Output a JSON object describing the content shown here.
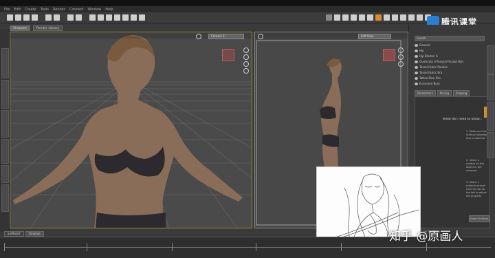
{
  "menu": {
    "items": [
      "File",
      "Edit",
      "Create",
      "Tools",
      "Render",
      "Connect",
      "Window",
      "Help"
    ]
  },
  "viewport_tabs": {
    "viewport": "Viewport",
    "render_library": "Render Library"
  },
  "viewport1": {
    "camera": "Camera 2"
  },
  "viewport2": {
    "camera": "Left View"
  },
  "scene_panel": {
    "search": "Search",
    "items": [
      "Genesis",
      "Hip",
      "Hip Blocker A",
      "Gumscalp 3 Ponytail Sculpt Hair",
      "Tassel Fabric Panties",
      "Tassel Fabric Bra",
      "Tattoo Rear Bra",
      "Extracted Bust"
    ]
  },
  "params_tabs": [
    "Parameters",
    "Posing",
    "Shaping"
  ],
  "lesson": {
    "heading": "What do I need to know...",
    "steps": [
      "1. Make sure the Surface Selection tool is selected",
      "2. Select a surface on the object in the viewport",
      "3. Select a material preset from the list on the left to adjust the property"
    ],
    "footer_btn": "Close Surfaces",
    "panel_label": "Shape Surfaces"
  },
  "bottom_tabs": {
    "aniMate": "aniMate2",
    "timeline": "Timeline"
  },
  "watermark": {
    "top": "腾讯课堂",
    "bottom": "知乎 @原画人"
  },
  "colors": {
    "viewport_border": "#9a8840",
    "accent": "#d98c2f",
    "brand_blue": "#2a7fd0"
  }
}
